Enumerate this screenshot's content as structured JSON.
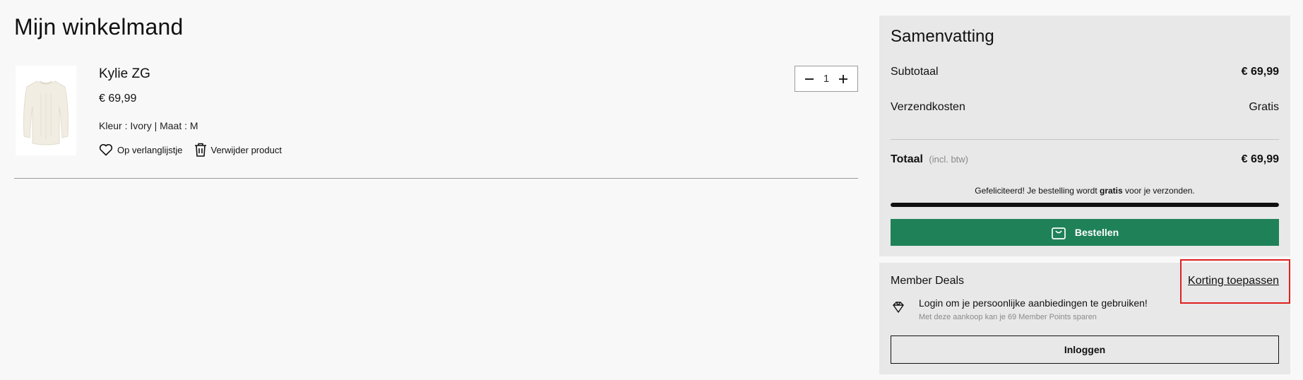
{
  "page": {
    "title": "Mijn winkelmand"
  },
  "cart": {
    "item": {
      "name": "Kylie ZG",
      "price": "€ 69,99",
      "attributes": "Kleur : Ivory |  Maat : M",
      "quantity": "1",
      "wishlist_label": "Op verlanglijstje",
      "remove_label": "Verwijder product",
      "image_icon": "ivory-knit-sweater"
    }
  },
  "summary": {
    "title": "Samenvatting",
    "subtotal_label": "Subtotaal",
    "subtotal_value": "€ 69,99",
    "shipping_label": "Verzendkosten",
    "shipping_value": "Gratis",
    "total_label": "Totaal",
    "total_note": "(incl. btw)",
    "total_value": "€ 69,99",
    "free_shipping_msg_pre": "Gefeliciteerd! Je bestelling wordt ",
    "free_shipping_msg_bold": "gratis",
    "free_shipping_msg_post": " voor je verzonden.",
    "free_shipping_progress": 1.0,
    "order_button": "Bestellen",
    "order_icon": "shopping-bag-icon",
    "accent_color": "#1f8158"
  },
  "deals": {
    "title": "Member Deals",
    "apply_discount_link": "Korting toepassen",
    "login_prompt": "Login om je persoonlijke aanbiedingen te gebruiken!",
    "points_note": "Met deze aankoop kan je 69 Member Points sparen",
    "login_button": "Inloggen",
    "deal_icon": "diamond-icon"
  }
}
